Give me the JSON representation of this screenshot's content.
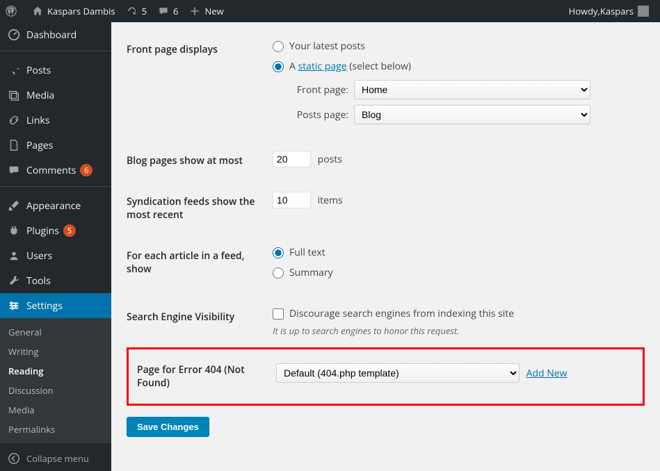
{
  "adminbar": {
    "site_name": "Kaspars Dambis",
    "updates_count": "5",
    "comments_count": "6",
    "new_label": "New",
    "howdy_prefix": "Howdy, ",
    "user_name": "Kaspars"
  },
  "sidebar": {
    "items": [
      {
        "label": "Dashboard",
        "icon": "dashboard"
      },
      {
        "label": "Posts",
        "icon": "pin"
      },
      {
        "label": "Media",
        "icon": "media"
      },
      {
        "label": "Links",
        "icon": "link"
      },
      {
        "label": "Pages",
        "icon": "page"
      },
      {
        "label": "Comments",
        "icon": "comment",
        "badge": "6"
      },
      {
        "label": "Appearance",
        "icon": "brush"
      },
      {
        "label": "Plugins",
        "icon": "plugin",
        "badge": "5"
      },
      {
        "label": "Users",
        "icon": "users"
      },
      {
        "label": "Tools",
        "icon": "tools"
      },
      {
        "label": "Settings",
        "icon": "settings",
        "current": true
      }
    ],
    "submenu": [
      "General",
      "Writing",
      "Reading",
      "Discussion",
      "Media",
      "Permalinks"
    ],
    "submenu_current": "Reading",
    "collapse_label": "Collapse menu"
  },
  "settings": {
    "front_page": {
      "heading": "Front page displays",
      "opt_latest": "Your latest posts",
      "opt_static_pre": "A ",
      "opt_static_link": "static page",
      "opt_static_post": " (select below)",
      "front_page_label": "Front page:",
      "front_page_value": "Home",
      "posts_page_label": "Posts page:",
      "posts_page_value": "Blog"
    },
    "blog_pages": {
      "heading": "Blog pages show at most",
      "value": "20",
      "unit": "posts"
    },
    "syndication": {
      "heading": "Syndication feeds show the most recent",
      "value": "10",
      "unit": "items"
    },
    "feed_article": {
      "heading": "For each article in a feed, show",
      "opt_full": "Full text",
      "opt_summary": "Summary"
    },
    "seo": {
      "heading": "Search Engine Visibility",
      "checkbox_label": "Discourage search engines from indexing this site",
      "note": "It is up to search engines to honor this request."
    },
    "error404": {
      "heading": "Page for Error 404 (Not Found)",
      "value": "Default (404.php template)",
      "add_new": "Add New"
    },
    "save_label": "Save Changes"
  }
}
